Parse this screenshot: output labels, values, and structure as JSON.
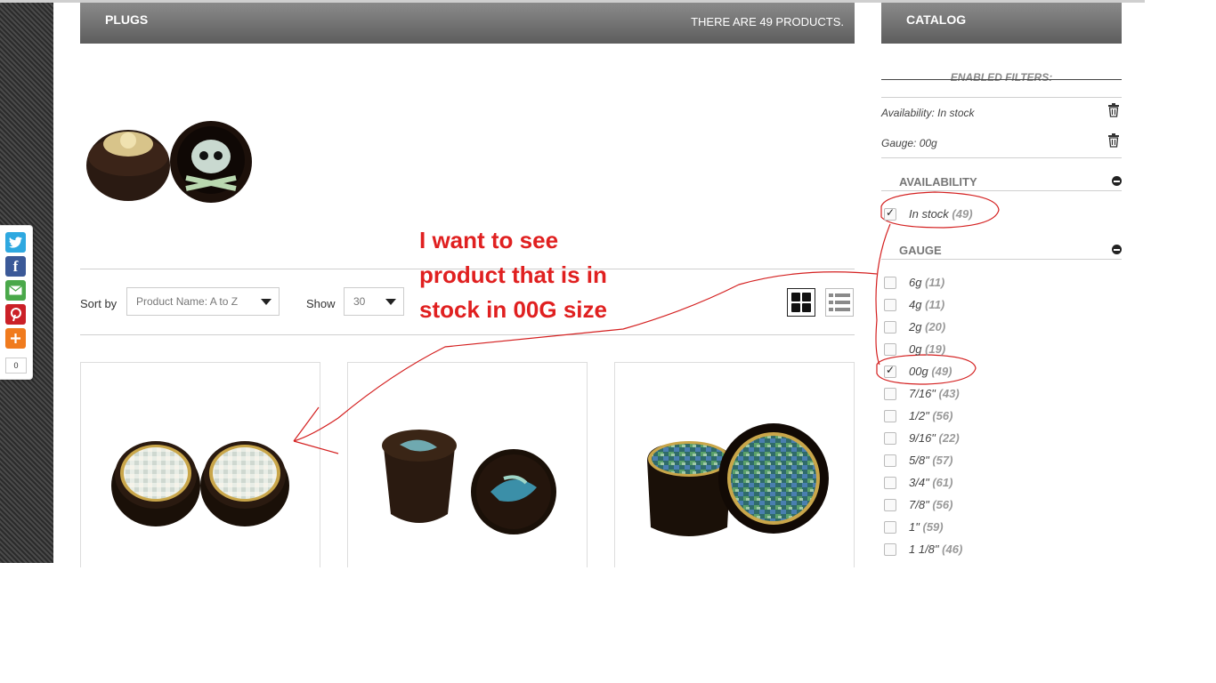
{
  "header": {
    "title": "PLUGS",
    "product_count": "THERE ARE 49 PRODUCTS."
  },
  "catalog": {
    "title": "CATALOG"
  },
  "share": {
    "count": "0",
    "icons": [
      "twitter-icon",
      "facebook-icon",
      "email-icon",
      "pinterest-icon",
      "share-icon"
    ]
  },
  "toolbar": {
    "sort_label": "Sort by",
    "sort_value": "Product Name: A to Z",
    "show_label": "Show",
    "show_value": "30"
  },
  "annotation": {
    "text": "I want to see product that is in stock in 00G size"
  },
  "filters": {
    "enabled_title": "ENABLED FILTERS:",
    "enabled": [
      "Availability: In stock",
      "Gauge: 00g"
    ],
    "availability": {
      "title": "AVAILABILITY",
      "options": [
        {
          "label": "In stock",
          "count": "(49)",
          "checked": true
        }
      ]
    },
    "gauge": {
      "title": "GAUGE",
      "options": [
        {
          "label": "6g",
          "count": "(11)",
          "checked": false
        },
        {
          "label": "4g",
          "count": "(11)",
          "checked": false
        },
        {
          "label": "2g",
          "count": "(20)",
          "checked": false
        },
        {
          "label": "0g",
          "count": "(19)",
          "checked": false
        },
        {
          "label": "00g",
          "count": "(49)",
          "checked": true
        },
        {
          "label": "7/16\"",
          "count": "(43)",
          "checked": false
        },
        {
          "label": "1/2\"",
          "count": "(56)",
          "checked": false
        },
        {
          "label": "9/16\"",
          "count": "(22)",
          "checked": false
        },
        {
          "label": "5/8\"",
          "count": "(57)",
          "checked": false
        },
        {
          "label": "3/4\"",
          "count": "(61)",
          "checked": false
        },
        {
          "label": "7/8\"",
          "count": "(56)",
          "checked": false
        },
        {
          "label": "1\"",
          "count": "(59)",
          "checked": false
        },
        {
          "label": "1 1/8\"",
          "count": "(46)",
          "checked": false
        }
      ]
    }
  },
  "colors": {
    "annotation": "#e02020",
    "header_bg": "#6e6e6e"
  }
}
